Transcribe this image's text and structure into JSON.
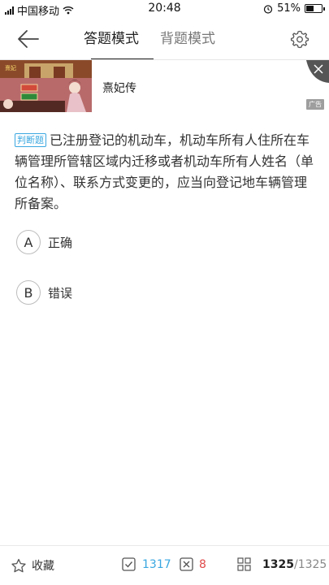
{
  "status_bar": {
    "carrier": "中国移动",
    "time": "20:48",
    "battery": "51%",
    "battery_level": 0.51
  },
  "nav": {
    "tabs": [
      {
        "label": "答题模式",
        "active": true
      },
      {
        "label": "背题模式",
        "active": false
      }
    ]
  },
  "ad": {
    "title": "熹妃传",
    "badge": "广告"
  },
  "question": {
    "type_label": "判断题",
    "text": "已注册登记的机动车，机动车所有人住所在车辆管理所管辖区域内迁移或者机动车所有人姓名（单位名称）、联系方式变更的，应当向登记地车辆管理所备案。"
  },
  "options": [
    {
      "letter": "A",
      "text": "正确"
    },
    {
      "letter": "B",
      "text": "错误"
    }
  ],
  "bottom_bar": {
    "favorite_label": "收藏",
    "correct_count": "1317",
    "wrong_count": "8",
    "current": "1325",
    "separator": "/",
    "total": "1325"
  },
  "colors": {
    "accent_blue": "#3aa7e0",
    "wrong_red": "#e04a4a"
  }
}
